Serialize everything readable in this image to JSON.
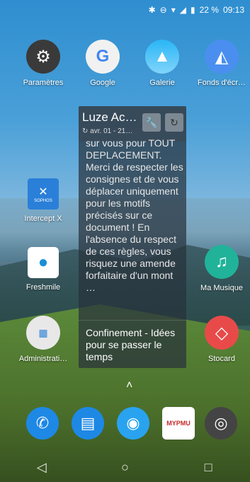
{
  "status": {
    "battery_percent": "22 %",
    "time": "09:13"
  },
  "apps_row1": [
    {
      "label": "Paramètres",
      "icon": "gear-icon"
    },
    {
      "label": "Google",
      "icon": "google-folder-icon"
    },
    {
      "label": "Galerie",
      "icon": "gallery-icon"
    },
    {
      "label": "Fonds d'écr…",
      "icon": "wallpaper-icon"
    }
  ],
  "apps_left": [
    {
      "label": "Intercept X",
      "icon": "sophos-icon",
      "icon_text": "SOPHOS"
    },
    {
      "label": "Freshmile",
      "icon": "freshmile-icon"
    },
    {
      "label": "Administrati…",
      "icon": "admin-folder-icon"
    }
  ],
  "apps_right": [
    {
      "label": "Ma Musique",
      "icon": "music-icon"
    },
    {
      "label": "Stocard",
      "icon": "stocard-icon"
    }
  ],
  "widget": {
    "title": "Luze Ac…",
    "date": "avr. 01 - 21…",
    "text": "sur vous pour TOUT DEPLACEMENT. Merci de respecter les consignes et de vous déplacer uniquement pour les motifs précisés sur ce document ! En l'absence du respect de ces règles, vous risquez une amende forfaitaire d'un mont …",
    "item2": "Confinement - Idées pour se passer le temps"
  },
  "dock": [
    {
      "icon": "phone-icon"
    },
    {
      "icon": "messages-icon"
    },
    {
      "icon": "contacts-icon"
    },
    {
      "icon": "mypmu-icon",
      "icon_text": "MYPMU"
    },
    {
      "icon": "camera-icon"
    }
  ]
}
